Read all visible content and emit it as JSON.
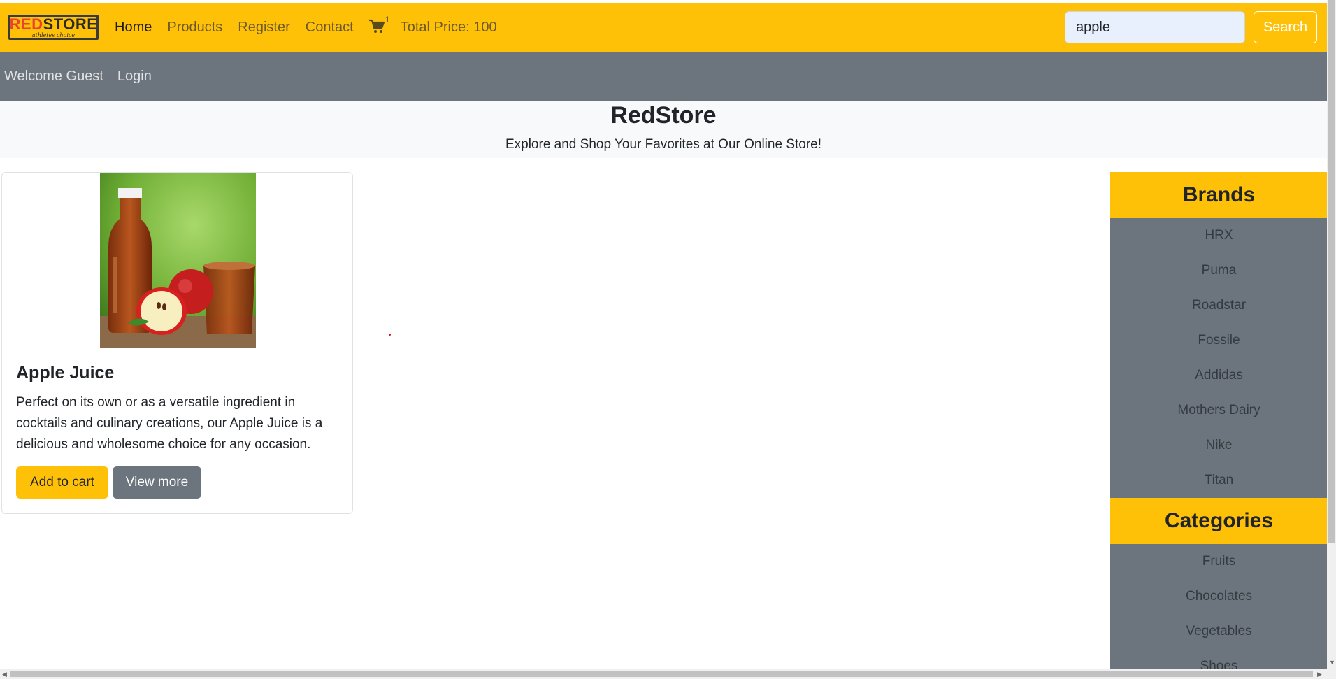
{
  "logo": {
    "red": "RED",
    "dark": "STORE",
    "tagline": "athletes choice"
  },
  "nav": {
    "home": "Home",
    "products": "Products",
    "register": "Register",
    "contact": "Contact",
    "cart_count": "1",
    "total_price": "Total Price: 100"
  },
  "search": {
    "value": "apple",
    "button": "Search"
  },
  "subnav": {
    "welcome": "Welcome Guest",
    "login": "Login"
  },
  "hero": {
    "title": "RedStore",
    "subtitle": "Explore and Shop Your Favorites at Our Online Store!"
  },
  "product": {
    "title": "Apple Juice",
    "description": "Perfect on its own or as a versatile ingredient in cocktails and culinary creations, our Apple Juice is a delicious and wholesome choice for any occasion.",
    "add_to_cart": "Add to cart",
    "view_more": "View more"
  },
  "sidebar": {
    "brands_title": "Brands",
    "brands": [
      "HRX",
      "Puma",
      "Roadstar",
      "Fossile",
      "Addidas",
      "Mothers Dairy",
      "Nike",
      "Titan"
    ],
    "categories_title": "Categories",
    "categories": [
      "Fruits",
      "Chocolates",
      "Vegetables",
      "Shoes"
    ]
  },
  "colors": {
    "accent": "#ffc107",
    "secondary": "#6c757d",
    "hero_bg": "#f8f9fa"
  }
}
